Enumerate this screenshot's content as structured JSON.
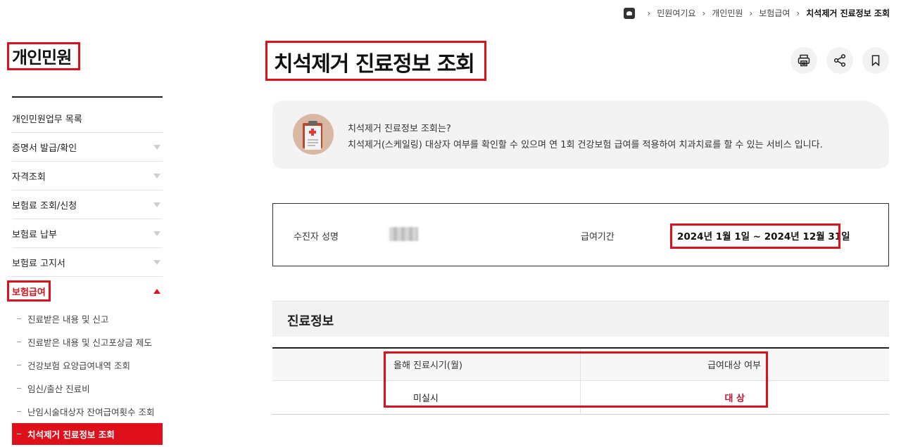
{
  "breadcrumb": {
    "items": [
      "민원여기요",
      "개인민원",
      "보험급여"
    ],
    "current": "치석제거 진료정보 조회"
  },
  "sidebar": {
    "title": "개인민원",
    "items": [
      {
        "label": "개인민원업무 목록"
      },
      {
        "label": "증명서 발급/확인"
      },
      {
        "label": "자격조회"
      },
      {
        "label": "보험료 조회/신청"
      },
      {
        "label": "보험료 납부"
      },
      {
        "label": "보험료 고지서"
      },
      {
        "label": "보험급여"
      }
    ],
    "subitems": [
      "진료받은 내용 및 신고",
      "진료받은 내용 및 신고포상금 제도",
      "건강보험 요양급여내역 조회",
      "임신/출산 진료비",
      "난임시술대상자 잔여급여횟수 조회",
      "치석제거 진료정보 조회"
    ]
  },
  "page": {
    "title": "치석제거 진료정보 조회",
    "tools": [
      "print-icon",
      "share-icon",
      "bookmark-icon"
    ]
  },
  "intro": {
    "question": "치석제거 진료정보 조회는?",
    "description": "치석제거(스케일링) 대상자 여부를 확인할 수 있으며 연 1회 건강보험 급여를 적용하여 치과치료를 할 수 있는 서비스 입니다."
  },
  "info": {
    "name_label": "수진자 성명",
    "period_label": "급여기간",
    "period_value": "2024년 1월 1일 ~ 2024년 12월 31일"
  },
  "section": {
    "title": "진료정보",
    "columns": [
      "올해 진료시기(월)",
      "급여대상 여부"
    ],
    "rows": [
      [
        "미실시",
        "대 상"
      ]
    ]
  },
  "colors": {
    "accent": "#e0101a",
    "status_red": "#c8102e"
  }
}
